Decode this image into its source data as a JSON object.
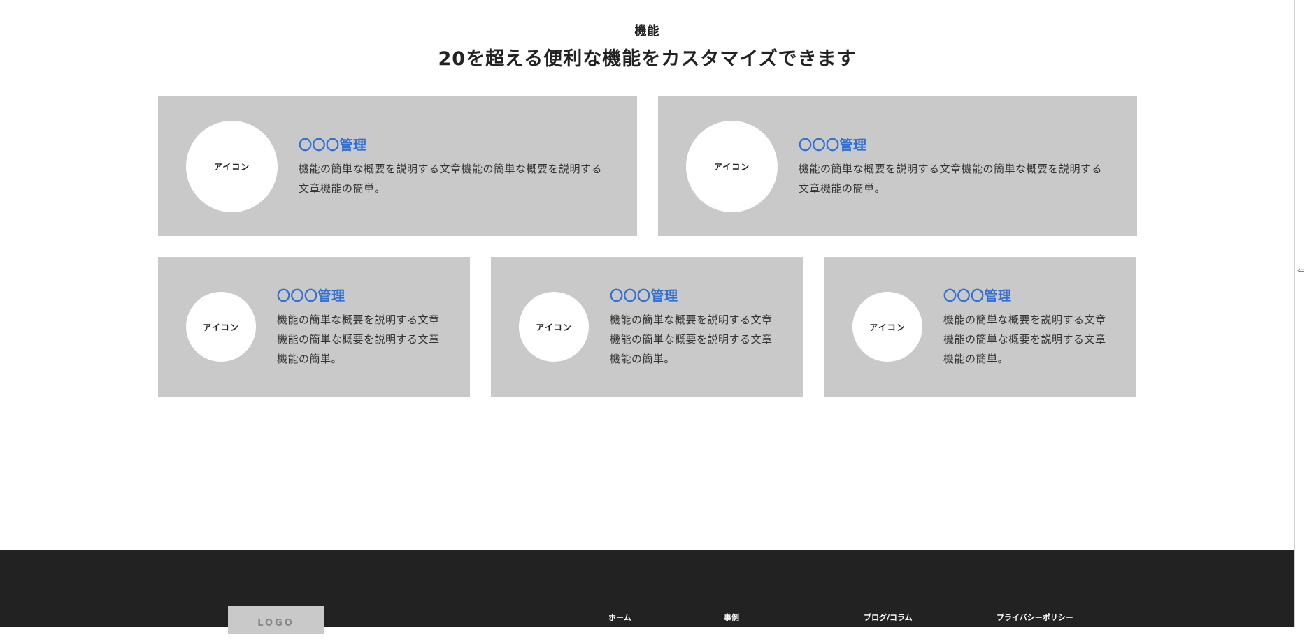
{
  "section": {
    "eyebrow": "機能",
    "heading": "20を超える便利な機能をカスタマイズできます"
  },
  "features": [
    {
      "icon_label": "アイコン",
      "title": "〇〇〇管理",
      "description": "機能の簡単な概要を説明する文章機能の簡単な概要を説明する文章機能の簡単。"
    },
    {
      "icon_label": "アイコン",
      "title": "〇〇〇管理",
      "description": "機能の簡単な概要を説明する文章機能の簡単な概要を説明する文章機能の簡単。"
    },
    {
      "icon_label": "アイコン",
      "title": "〇〇〇管理",
      "description": "機能の簡単な概要を説明する文章機能の簡単な概要を説明する文章機能の簡単。"
    },
    {
      "icon_label": "アイコン",
      "title": "〇〇〇管理",
      "description": "機能の簡単な概要を説明する文章機能の簡単な概要を説明する文章機能の簡単。"
    },
    {
      "icon_label": "アイコン",
      "title": "〇〇〇管理",
      "description": "機能の簡単な概要を説明する文章機能の簡単な概要を説明する文章機能の簡単。"
    }
  ],
  "footer": {
    "logo": "LOGO",
    "links": [
      "ホーム",
      "事例",
      "ブログ/コラム",
      "プライバシーポリシー"
    ]
  },
  "colors": {
    "accent": "#2f6fd6",
    "card_bg": "#c9c9c9",
    "footer_bg": "#222222"
  },
  "icons": {
    "scroll_handle": "resize-handle-icon"
  }
}
